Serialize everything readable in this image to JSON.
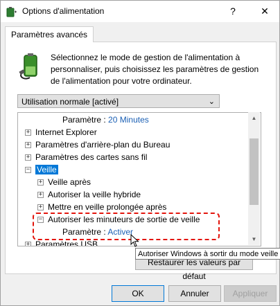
{
  "window": {
    "title": "Options d'alimentation",
    "help": "?",
    "close": "✕"
  },
  "tab": {
    "label": "Paramètres avancés"
  },
  "description": "Sélectionnez le mode de gestion de l'alimentation à personnaliser, puis choisissez les paramètres de gestion de l'alimentation pour votre ordinateur.",
  "plan_select": {
    "value": "Utilisation normale [activé]"
  },
  "tree": {
    "param_label": "Paramètre :",
    "top_value": "20 Minutes",
    "items": {
      "ie": "Internet Explorer",
      "desktop_bg": "Paramètres d'arrière-plan du Bureau",
      "wireless": "Paramètres des cartes sans fil",
      "sleep": "Veille",
      "sleep_after": "Veille après",
      "hybrid": "Autoriser la veille hybride",
      "hibernate": "Mettre en veille prolongée après",
      "wake_timers": "Autoriser les minuteurs de sortie de veille",
      "wake_value": "Activer",
      "usb": "Paramètres USB"
    },
    "expand_symbol": "+",
    "collapse_symbol": "−"
  },
  "restore_button": "Restaurer les valeurs par défaut",
  "tooltip": "Autoriser Windows à sortir du mode veille",
  "buttons": {
    "ok": "OK",
    "cancel": "Annuler",
    "apply": "Appliquer"
  },
  "colors": {
    "selection": "#0078d7",
    "value_link": "#1a5fb4",
    "highlight": "#e3140b"
  }
}
